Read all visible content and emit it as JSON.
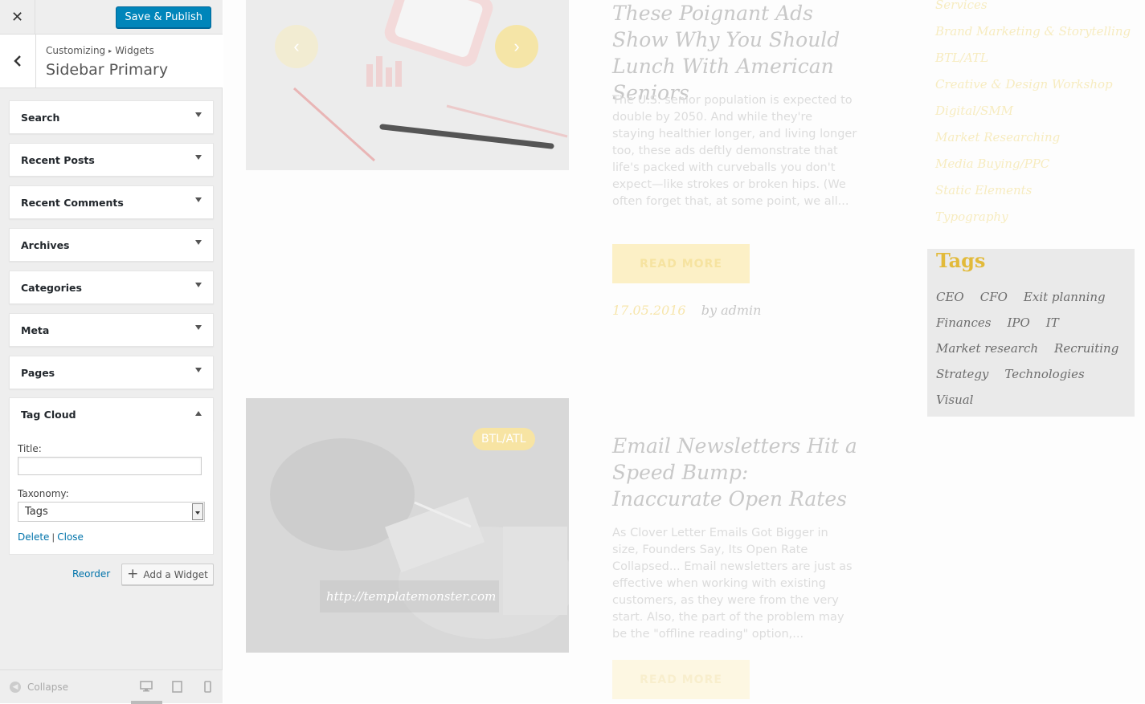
{
  "customizer": {
    "save_label": "Save & Publish",
    "breadcrumb": [
      "Customizing",
      "Widgets"
    ],
    "panel_title": "Sidebar Primary",
    "widgets": [
      {
        "title": "Search"
      },
      {
        "title": "Recent Posts"
      },
      {
        "title": "Recent Comments"
      },
      {
        "title": "Archives"
      },
      {
        "title": "Categories"
      },
      {
        "title": "Meta"
      },
      {
        "title": "Pages"
      },
      {
        "title": "Tag Cloud"
      }
    ],
    "tag_cloud_form": {
      "title_label": "Title:",
      "title_value": "",
      "taxonomy_label": "Taxonomy:",
      "taxonomy_value": "Tags",
      "delete_label": "Delete",
      "separator": "|",
      "close_label": "Close"
    },
    "reorder_label": "Reorder",
    "add_widget_label": "Add a Widget",
    "collapse_label": "Collapse",
    "colors": {
      "primary_button": "#0085ba",
      "link": "#0073aa"
    }
  },
  "preview": {
    "post1": {
      "title": "These Poignant Ads Show Why You Should Lunch With American Seniors",
      "excerpt": "The U.S. senior population is expected to double by 2050. And while they're staying healthier longer, and living longer too, these ads deftly demonstrate that life's packed with curveballs you don't expect—like strokes or broken hips. (We often forget that, at some point, we all...",
      "read_more": "READ MORE",
      "date": "17.05.2016",
      "author": "by admin"
    },
    "post2": {
      "badge": "BTL/ATL",
      "image_link": "http://templatemonster.com",
      "title": "Email Newsletters Hit a Speed Bump: Inaccurate Open Rates",
      "excerpt": "  As Clover Letter Emails Got Bigger in size, Founders Say, Its Open Rate Collapsed... Email newsletters are just as effective when working with existing customers, as they were from the very start.  Also, the part of the problem may be the \"offline reading\" option,...",
      "read_more": "READ MORE"
    },
    "categories": [
      "Services",
      "Brand Marketing & Storytelling",
      "BTL/ATL",
      "Creative & Design Workshop",
      "Digital/SMM",
      "Market Researching",
      "Media Buying/PPC",
      "Static Elements",
      "Typography"
    ],
    "tags_title": "Tags",
    "tags": [
      "CEO",
      "CFO",
      "Exit planning",
      "Finances",
      "IPO",
      "IT",
      "Market research",
      "Recruiting",
      "Strategy",
      "Technologies",
      "Visual"
    ],
    "colors": {
      "accent": "#e2ba3a"
    }
  }
}
